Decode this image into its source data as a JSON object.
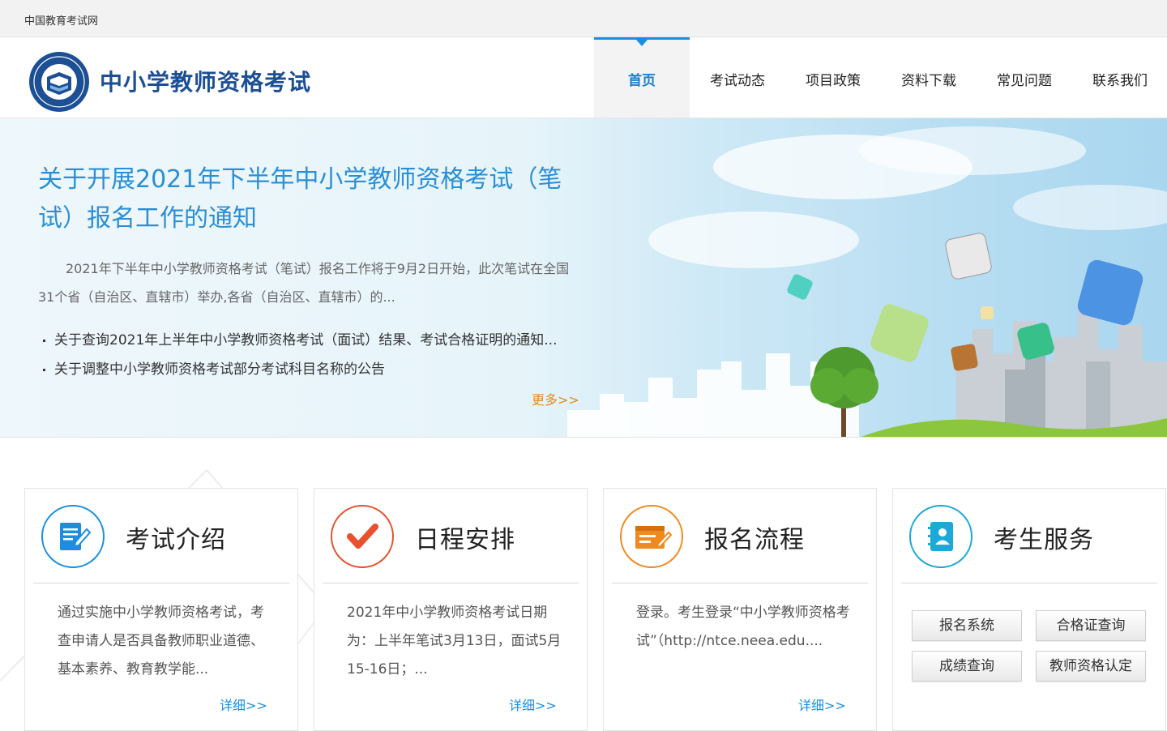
{
  "topbar": {
    "site_link": "中国教育考试网"
  },
  "header": {
    "logo_title": "中小学教师资格考试",
    "nav": [
      {
        "label": "首页",
        "active": true
      },
      {
        "label": "考试动态"
      },
      {
        "label": "项目政策"
      },
      {
        "label": "资料下载"
      },
      {
        "label": "常见问题"
      },
      {
        "label": "联系我们"
      }
    ]
  },
  "banner": {
    "headline": "关于开展2021年下半年中小学教师资格考试（笔试）报名工作的通知",
    "summary": "2021年下半年中小学教师资格考试（笔试）报名工作将于9月2日开始，此次笔试在全国31个省（自治区、直辖市）举办,各省（自治区、直辖市）的...",
    "news": [
      "关于查询2021年上半年中小学教师资格考试（面试）结果、考试合格证明的通知...",
      "关于调整中小学教师资格考试部分考试科目名称的公告"
    ],
    "more": "更多>>"
  },
  "cards": [
    {
      "title": "考试介绍",
      "icon": "document-pen-icon",
      "color": "#1a8fe0",
      "text": "通过实施中小学教师资格考试，考查申请人是否具备教师职业道德、基本素养、教育教学能...",
      "detail": "详细>>"
    },
    {
      "title": "日程安排",
      "icon": "checkmark-icon",
      "color": "#e8502e",
      "text": "2021年中小学教师资格考试日期为：上半年笔试3月13日，面试5月15-16日；...",
      "detail": "详细>>"
    },
    {
      "title": "报名流程",
      "icon": "form-edit-icon",
      "color": "#f08a1e",
      "text": "登录。考生登录“中小学教师资格考试”（http://ntce.neea.edu....",
      "detail": "详细>>"
    },
    {
      "title": "考生服务",
      "icon": "contact-book-icon",
      "color": "#1aa9d8",
      "buttons": [
        "报名系统",
        "合格证查询",
        "成绩查询",
        "教师资格认定"
      ]
    }
  ]
}
